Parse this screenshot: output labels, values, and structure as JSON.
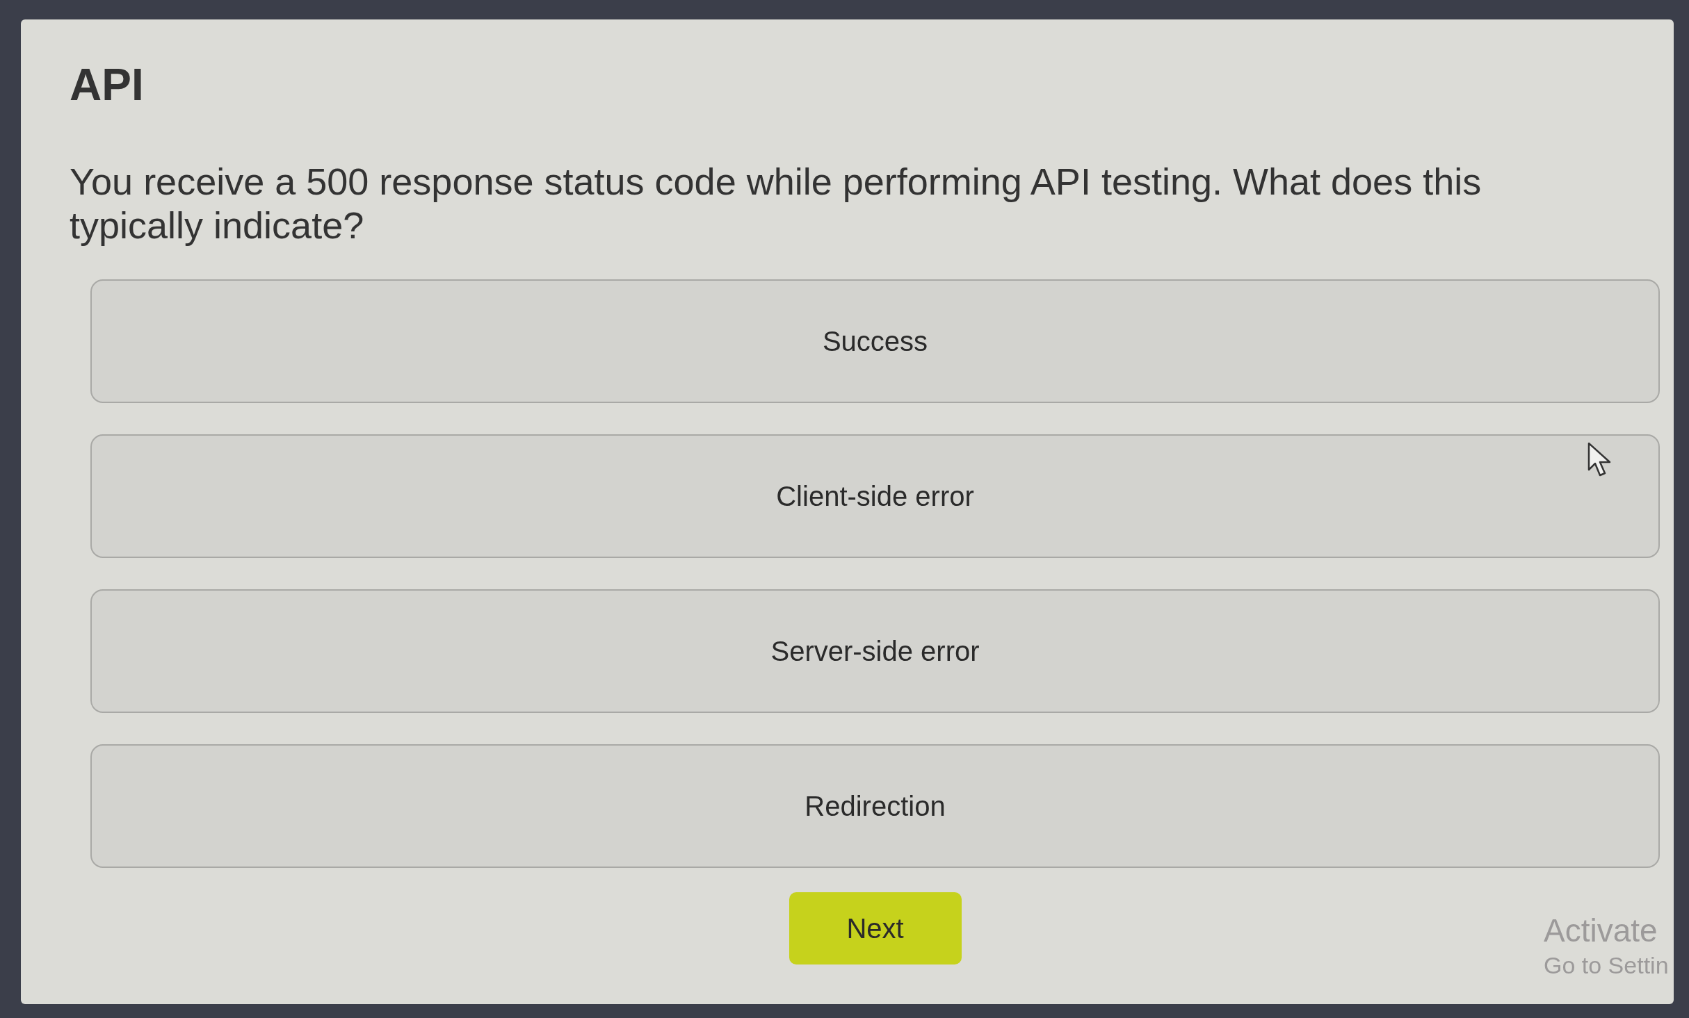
{
  "quiz": {
    "title": "API",
    "question": "You receive a 500 response status code while performing API testing. What does this typically indicate?"
  },
  "options": [
    {
      "label": "Success",
      "selected": false
    },
    {
      "label": "Client-side error",
      "selected": false
    },
    {
      "label": "Server-side error",
      "selected": false
    },
    {
      "label": "Redirection",
      "selected": false
    }
  ],
  "next_button": {
    "label": "Next"
  },
  "os_watermark": {
    "lines": [
      "Activate",
      "Go to Settin"
    ]
  }
}
